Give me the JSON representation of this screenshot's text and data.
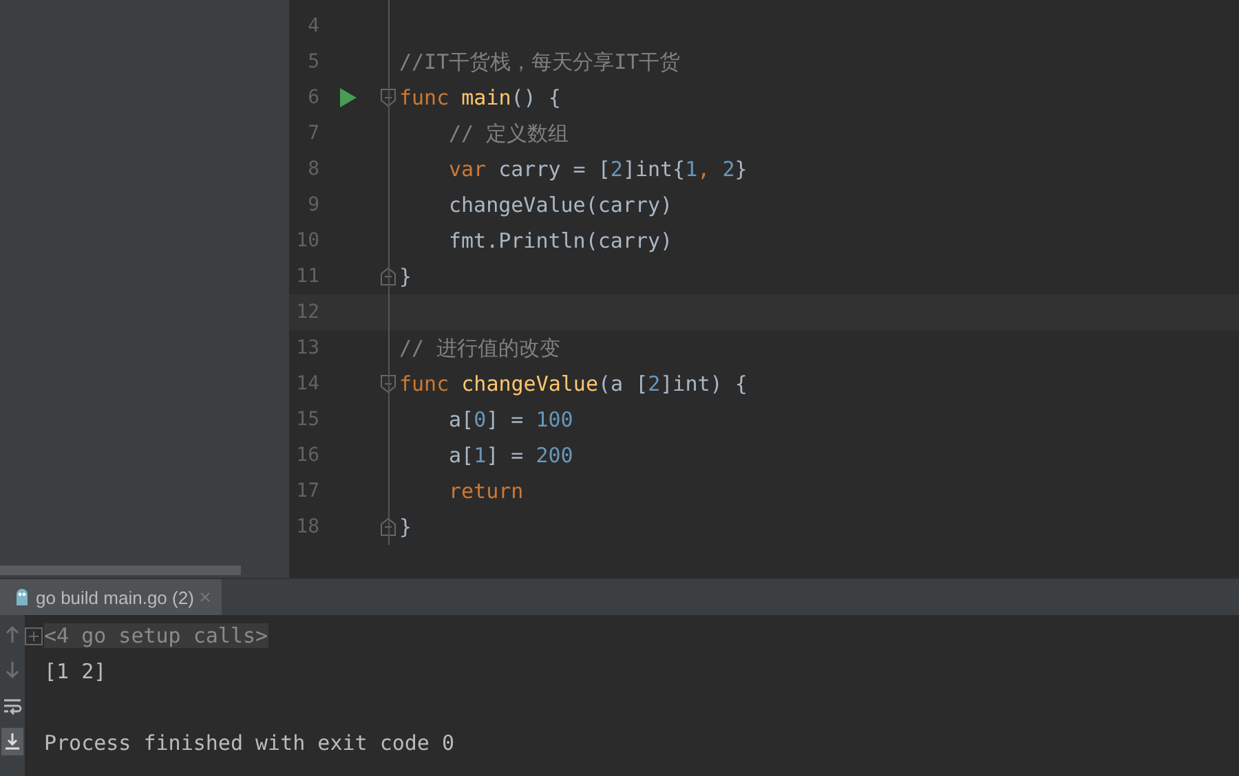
{
  "editor": {
    "lines": [
      {
        "number": "4"
      },
      {
        "number": "5",
        "tokens": [
          {
            "kind": "comment",
            "text": "//IT干货栈，每天分享IT干货"
          }
        ]
      },
      {
        "number": "6",
        "run": true,
        "fold_open": true,
        "tokens": [
          {
            "kind": "keyword",
            "text": "func "
          },
          {
            "kind": "function",
            "text": "main"
          },
          {
            "kind": "plain",
            "text": "() {"
          }
        ]
      },
      {
        "number": "7",
        "indented": true,
        "tokens": [
          {
            "kind": "comment",
            "text": "// 定义数组"
          }
        ]
      },
      {
        "number": "8",
        "indented": true,
        "tokens": [
          {
            "kind": "keyword",
            "text": "var "
          },
          {
            "kind": "plain",
            "text": "carry = ["
          },
          {
            "kind": "number",
            "text": "2"
          },
          {
            "kind": "plain",
            "text": "]int{"
          },
          {
            "kind": "number",
            "text": "1"
          },
          {
            "kind": "keyword",
            "text": ", "
          },
          {
            "kind": "number",
            "text": "2"
          },
          {
            "kind": "plain",
            "text": "}"
          }
        ]
      },
      {
        "number": "9",
        "indented": true,
        "tokens": [
          {
            "kind": "plain",
            "text": "changeValue(carry)"
          }
        ]
      },
      {
        "number": "10",
        "indented": true,
        "tokens": [
          {
            "kind": "plain",
            "text": "fmt.Println(carry)"
          }
        ]
      },
      {
        "number": "11",
        "fold_close": true,
        "tokens": [
          {
            "kind": "plain",
            "text": "}"
          }
        ]
      },
      {
        "number": "12",
        "current": true
      },
      {
        "number": "13",
        "tokens": [
          {
            "kind": "comment",
            "text": "// 进行值的改变"
          }
        ]
      },
      {
        "number": "14",
        "fold_open": true,
        "tokens": [
          {
            "kind": "keyword",
            "text": "func "
          },
          {
            "kind": "function",
            "text": "changeValue"
          },
          {
            "kind": "plain",
            "text": "(a ["
          },
          {
            "kind": "number",
            "text": "2"
          },
          {
            "kind": "plain",
            "text": "]int) {"
          }
        ]
      },
      {
        "number": "15",
        "indented": true,
        "tokens": [
          {
            "kind": "plain",
            "text": "a["
          },
          {
            "kind": "number",
            "text": "0"
          },
          {
            "kind": "plain",
            "text": "] = "
          },
          {
            "kind": "number",
            "text": "100"
          }
        ]
      },
      {
        "number": "16",
        "indented": true,
        "tokens": [
          {
            "kind": "plain",
            "text": "a["
          },
          {
            "kind": "number",
            "text": "1"
          },
          {
            "kind": "plain",
            "text": "] = "
          },
          {
            "kind": "number",
            "text": "200"
          }
        ]
      },
      {
        "number": "17",
        "indented": true,
        "tokens": [
          {
            "kind": "keyword",
            "text": "return"
          }
        ]
      },
      {
        "number": "18",
        "fold_close": true,
        "tokens": [
          {
            "kind": "plain",
            "text": "}"
          }
        ]
      }
    ]
  },
  "run_panel": {
    "tab": {
      "label": "go build main.go (2)",
      "selected": true
    },
    "toolbar": [
      {
        "kind": "up",
        "active": false
      },
      {
        "kind": "down",
        "active": false
      },
      {
        "kind": "wrap",
        "active": false
      },
      {
        "kind": "scroll-end",
        "active": true
      }
    ],
    "output": [
      {
        "kind": "folded",
        "text": "<4 go setup calls>"
      },
      {
        "kind": "plain",
        "text": "[1 2]"
      },
      {
        "kind": "blank"
      },
      {
        "kind": "plain",
        "text": "Process finished with exit code 0"
      }
    ]
  }
}
